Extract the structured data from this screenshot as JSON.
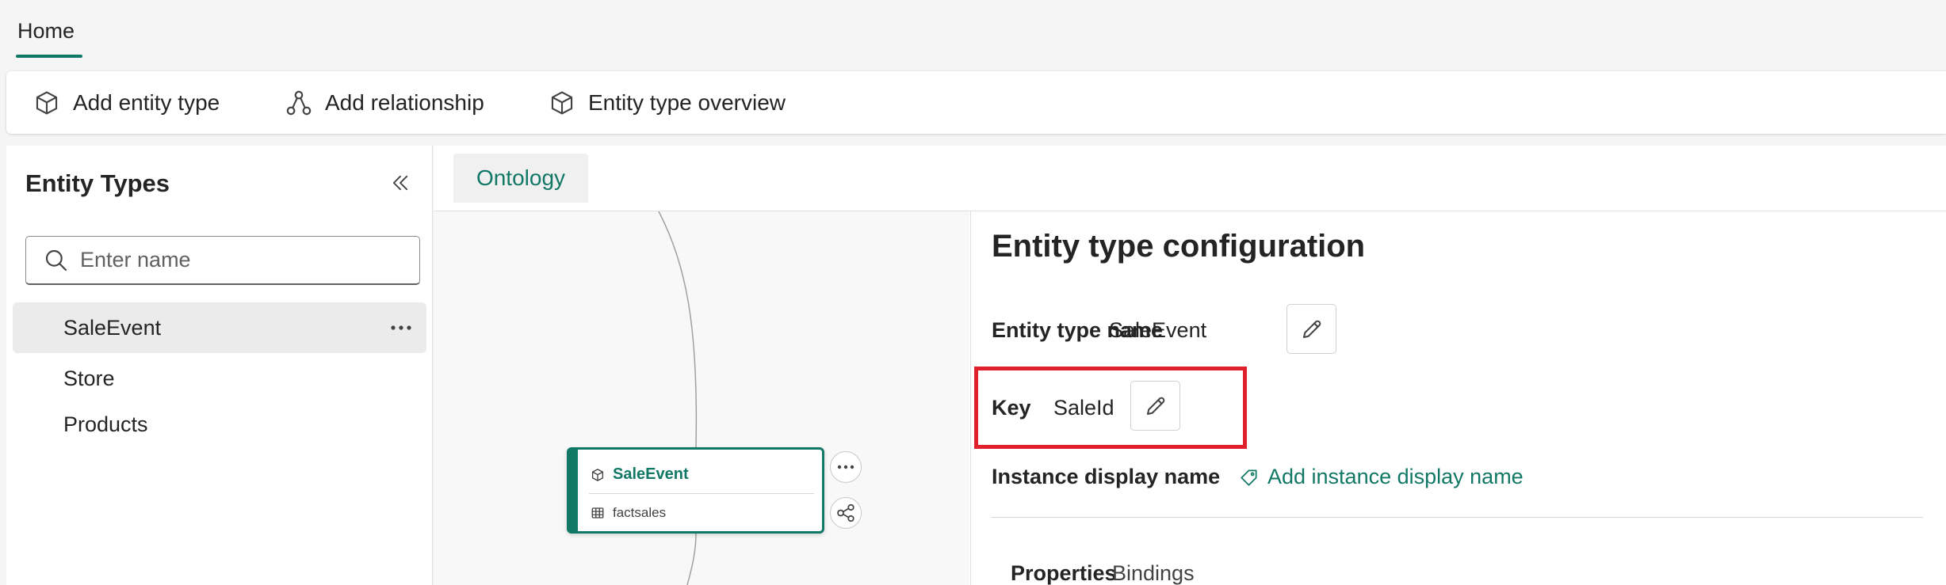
{
  "tabs": {
    "home": "Home"
  },
  "toolbar": {
    "add_entity_type": "Add entity type",
    "add_relationship": "Add relationship",
    "entity_type_overview": "Entity type overview"
  },
  "sidebar": {
    "title": "Entity Types",
    "search_placeholder": "Enter name",
    "items": [
      {
        "label": "SaleEvent",
        "selected": true
      },
      {
        "label": "Store",
        "selected": false
      },
      {
        "label": "Products",
        "selected": false
      }
    ]
  },
  "main": {
    "tab": "Ontology",
    "node": {
      "title": "SaleEvent",
      "source": "factsales"
    }
  },
  "config": {
    "title": "Entity type configuration",
    "entity_type_name_label": "Entity type name",
    "entity_type_name_value": "SaleEvent",
    "key_label": "Key",
    "key_value": "SaleId",
    "instance_display_label": "Instance display name",
    "add_instance_display": "Add instance display name",
    "tabs": {
      "properties": "Properties",
      "bindings": "Bindings"
    }
  },
  "colors": {
    "accent": "#117865",
    "highlight": "#e0202c"
  },
  "icons": [
    "cube-icon",
    "relationship-icon",
    "collapse-icon",
    "search-icon",
    "more-icon",
    "table-icon",
    "pencil-icon",
    "tag-icon"
  ]
}
